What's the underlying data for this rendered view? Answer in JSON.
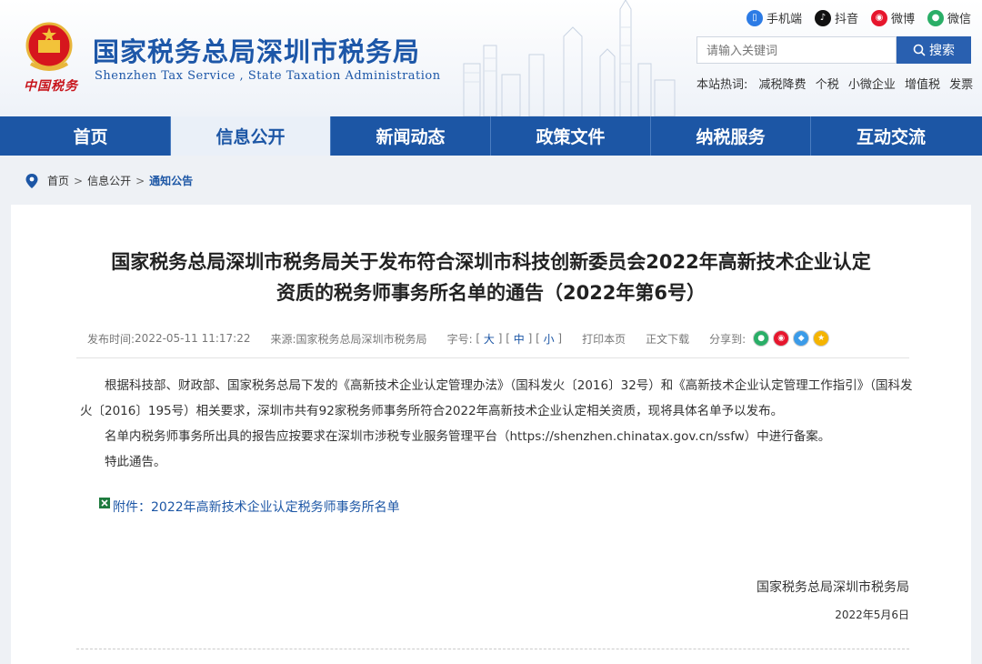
{
  "header": {
    "site_title_cn": "国家税务总局深圳市税务局",
    "site_title_en": "Shenzhen Tax Service , State Taxation Administration",
    "seal_text": "中国税务",
    "social": [
      {
        "label": "手机端",
        "icon": "mobile-icon",
        "color": "#2c7be5"
      },
      {
        "label": "抖音",
        "icon": "douyin-icon",
        "color": "#111111"
      },
      {
        "label": "微博",
        "icon": "weibo-icon",
        "color": "#e6162d"
      },
      {
        "label": "微信",
        "icon": "wechat-icon",
        "color": "#2aae67"
      }
    ],
    "search": {
      "placeholder": "请输入关键词",
      "button_label": "搜索"
    },
    "hotwords": {
      "label": "本站热词:",
      "items": [
        "减税降费",
        "个税",
        "小微企业",
        "增值税",
        "发票"
      ]
    }
  },
  "nav": {
    "items": [
      "首页",
      "信息公开",
      "新闻动态",
      "政策文件",
      "纳税服务",
      "互动交流"
    ],
    "active_index": 1
  },
  "breadcrumb": {
    "items": [
      "首页",
      "信息公开",
      "通知公告"
    ],
    "separator": ">"
  },
  "article": {
    "title_line1": "国家税务总局深圳市税务局关于发布符合深圳市科技创新委员会2022年高新技术企业认定",
    "title_line2": "资质的税务师事务所名单的通告（2022年第6号）",
    "meta": {
      "publish_label": "发布时间:",
      "publish_time": "2022-05-11 11:17:22",
      "source_label": "来源:",
      "source": "国家税务总局深圳市税务局",
      "font_label": "字号:",
      "font_sizes": [
        "大",
        "中",
        "小"
      ],
      "print": "打印本页",
      "download": "正文下载",
      "share_label": "分享到:"
    },
    "paragraphs": [
      "根据科技部、财政部、国家税务总局下发的《高新技术企业认定管理办法》（国科发火〔2016〕32号）和《高新技术企业认定管理工作指引》（国科发火〔2016〕195号）相关要求，深圳市共有92家税务师事务所符合2022年高新技术企业认定相关资质，现将具体名单予以发布。",
      "名单内税务师事务所出具的报告应按要求在深圳市涉税专业服务管理平台（https://shenzhen.chinatax.gov.cn/ssfw）中进行备案。",
      "特此通告。"
    ],
    "attachment": "附件：2022年高新技术企业认定税务师事务所名单",
    "signature": "国家税务总局深圳市税务局",
    "date": "2022年5月6日"
  },
  "colors": {
    "primary": "#1c56a5",
    "nav_active_bg": "#eaf0f8",
    "seal": "#c8161d"
  }
}
